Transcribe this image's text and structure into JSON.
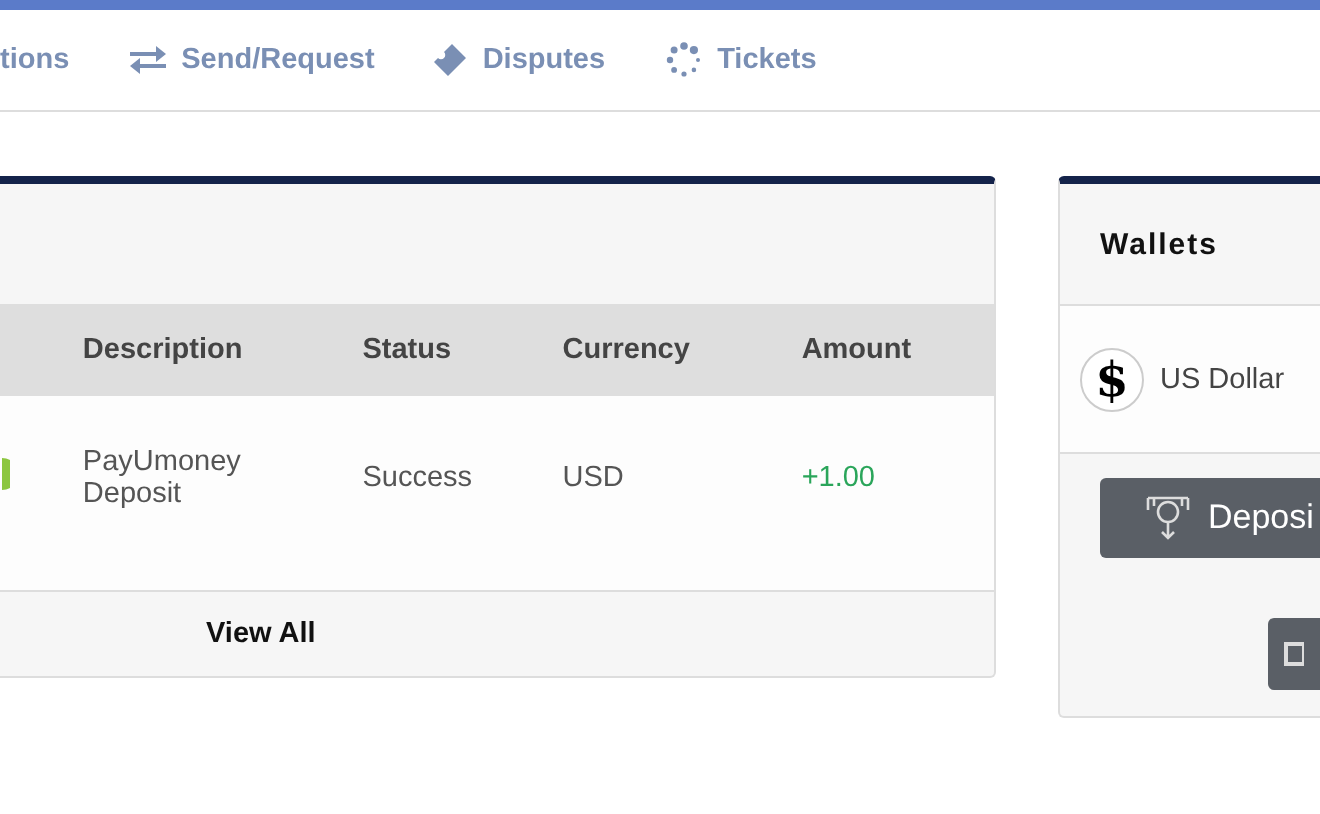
{
  "nav": [
    {
      "label": "tions",
      "kind": "plain"
    },
    {
      "label": "Send/Request",
      "kind": "arrows"
    },
    {
      "label": "Disputes",
      "kind": "ticket"
    },
    {
      "label": "Tickets",
      "kind": "spinner"
    }
  ],
  "transactions": {
    "columns": [
      "Description",
      "Status",
      "Currency",
      "Amount"
    ],
    "rows": [
      {
        "description": "PayUmoney Deposit",
        "status": "Success",
        "currency": "USD",
        "amount": "+1.00",
        "positive": true
      }
    ],
    "footer_link": "View All"
  },
  "wallets": {
    "title": "Wallets",
    "items": [
      {
        "symbol": "$",
        "name": "US Dollar"
      }
    ],
    "deposit_button": "Deposi"
  }
}
